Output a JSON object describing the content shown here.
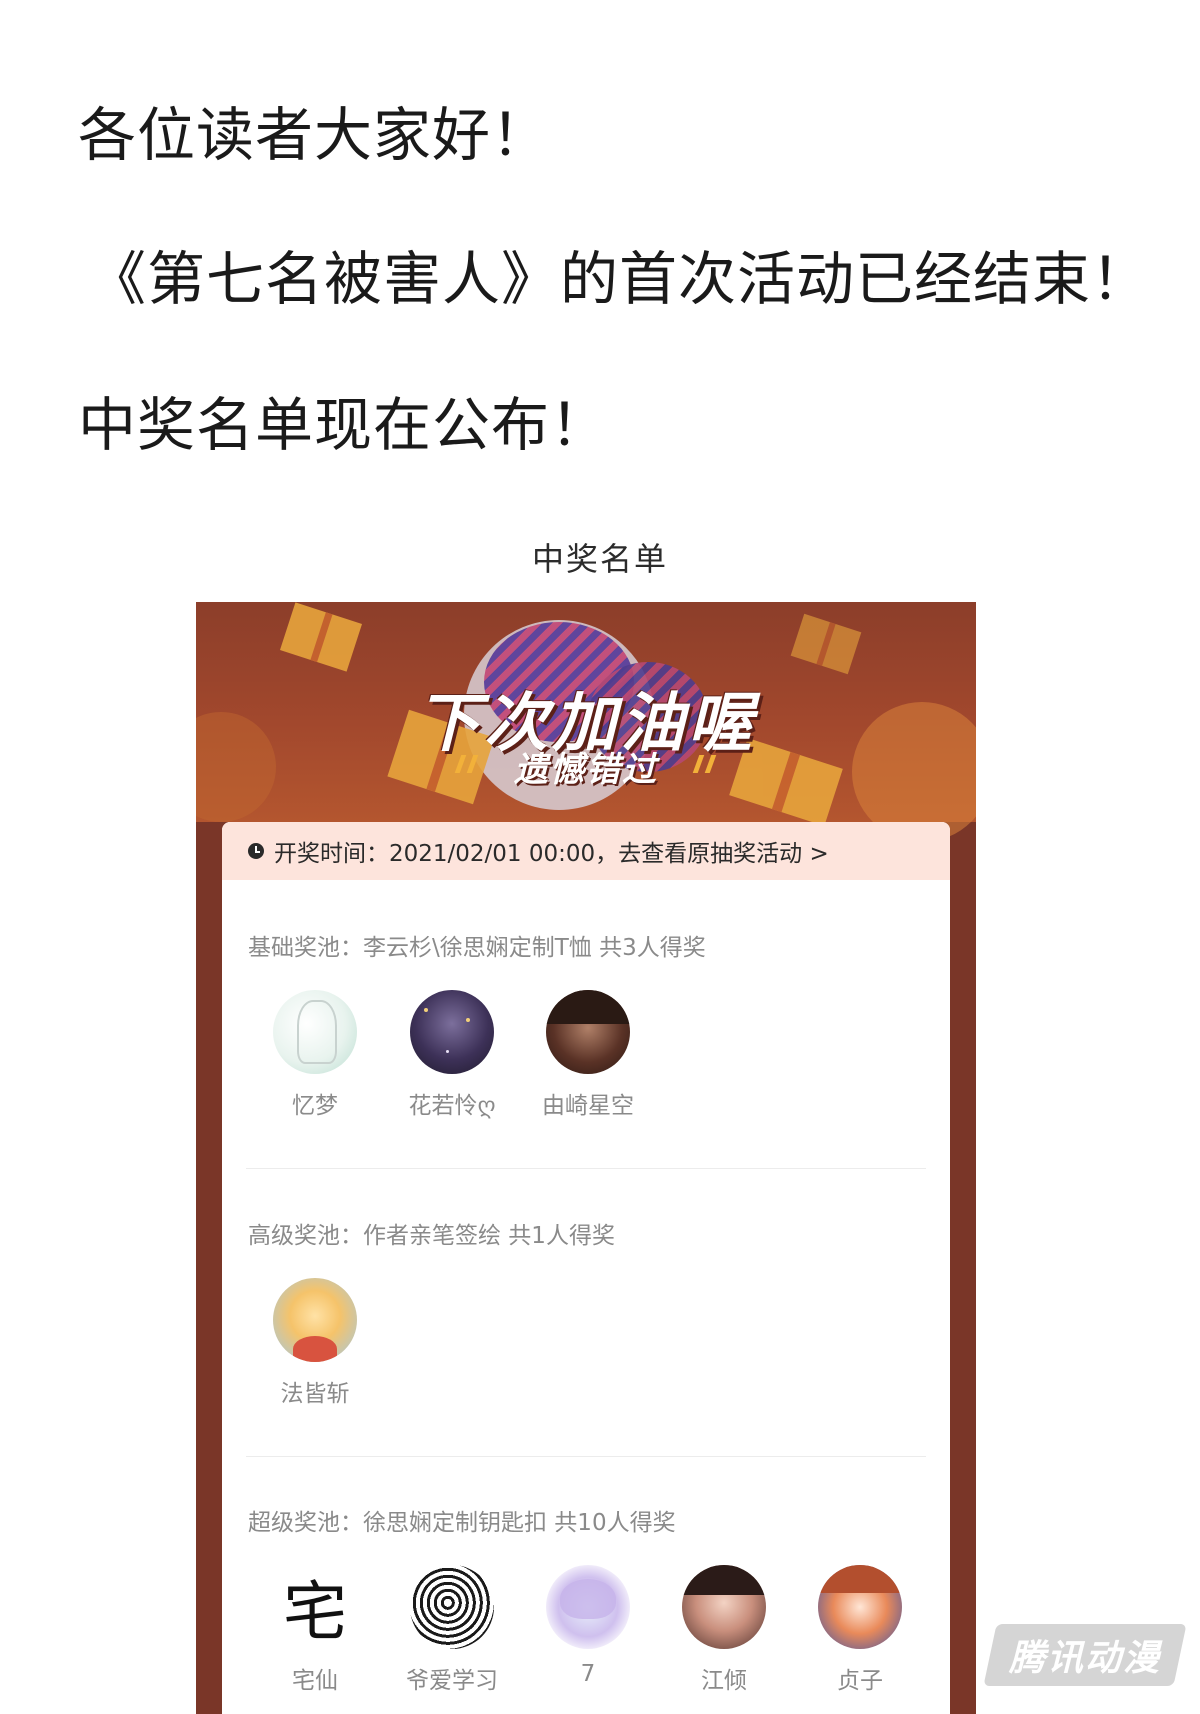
{
  "intro": {
    "line1": "各位读者大家好！",
    "line2": "《第七名被害人》的首次活动已经结束！",
    "line3": "中奖名单现在公布！"
  },
  "caption": "中奖名单",
  "banner": {
    "title": "下次加油喔",
    "subtitle": "遗憾错过"
  },
  "draw_bar": {
    "text": "开奖时间：2021/02/01 00:00，去查看原抽奖活动 >"
  },
  "pools": [
    {
      "title": "基础奖池：李云杉\\徐思娴定制T恤 共3人得奖",
      "winners": [
        "忆梦",
        "花若怜ღ",
        "由崎星空"
      ]
    },
    {
      "title": "高级奖池：作者亲笔签绘 共1人得奖",
      "winners": [
        "法皆斩"
      ]
    },
    {
      "title": "超级奖池：徐思娴定制钥匙扣 共10人得奖",
      "winners": [
        "宅仙",
        "爷爱学习",
        "7",
        "江倾",
        "贞子"
      ]
    }
  ],
  "avatar_glyph": "宅",
  "watermark": "腾讯动漫",
  "colors": {
    "card_bg": "#7a3628",
    "draw_bar_bg": "#fde4dc",
    "muted_text": "#8a8a8a"
  }
}
